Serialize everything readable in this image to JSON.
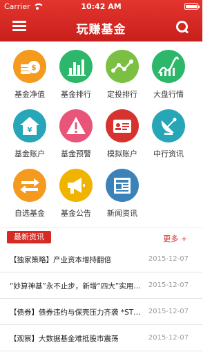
{
  "status_bar": {
    "carrier": "Carrier",
    "time": "10:42 AM"
  },
  "header": {
    "title": "玩赚基金",
    "menu_icon": "hamburger-menu-icon",
    "search_icon": "search-icon"
  },
  "colors": {
    "header_red": "#d62a24",
    "orange": "#f39a1f",
    "green": "#2db76a",
    "lime": "#7bc043",
    "teal": "#26a6b7",
    "pink": "#e8547a",
    "red": "#d6332e",
    "blue": "#3b82b8",
    "yellow": "#f0b400"
  },
  "grid": {
    "items": [
      {
        "label": "基金净值",
        "icon": "coins-dollar-icon"
      },
      {
        "label": "基金排行",
        "icon": "bar-chart-icon"
      },
      {
        "label": "定投排行",
        "icon": "line-trend-icon"
      },
      {
        "label": "大盘行情",
        "icon": "wave-chart-icon"
      },
      {
        "label": "基金账户",
        "icon": "house-yen-icon"
      },
      {
        "label": "基金预警",
        "icon": "warning-triangle-icon"
      },
      {
        "label": "模拟账户",
        "icon": "id-card-icon"
      },
      {
        "label": "中行资讯",
        "icon": "satellite-dish-icon"
      },
      {
        "label": "自选基金",
        "icon": "exchange-arrows-icon"
      },
      {
        "label": "基金公告",
        "icon": "megaphone-icon"
      },
      {
        "label": "新闻资讯",
        "icon": "newspaper-icon"
      }
    ]
  },
  "news_section": {
    "tag": "最新资讯",
    "more": "更多 +"
  },
  "news": [
    {
      "headline": "【独家策略】产业资本增持翻倍",
      "date": "2015-12-07"
    },
    {
      "headline": "“妙算神基”永不止步，新增“四大”实用…",
      "date": "2015-12-07"
    },
    {
      "headline": "【债券】债券违约与保壳压力齐袭 *ST…",
      "date": "2015-12-07"
    },
    {
      "headline": "【观察】大数据基金难抵股市震荡",
      "date": "2015-12-07"
    }
  ]
}
